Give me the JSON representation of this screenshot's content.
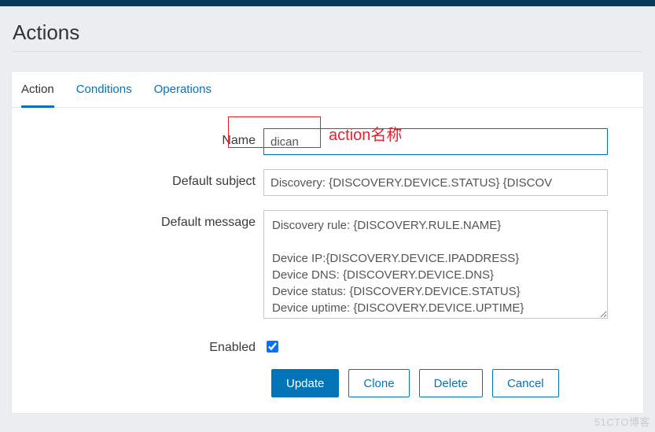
{
  "page": {
    "title": "Actions"
  },
  "tabs": {
    "action": "Action",
    "conditions": "Conditions",
    "operations": "Operations"
  },
  "form": {
    "labels": {
      "name": "Name",
      "default_subject": "Default subject",
      "default_message": "Default message",
      "enabled": "Enabled"
    },
    "values": {
      "name": "dican",
      "default_subject": "Discovery: {DISCOVERY.DEVICE.STATUS} {DISCOV",
      "default_message": "Discovery rule: {DISCOVERY.RULE.NAME}\n\nDevice IP:{DISCOVERY.DEVICE.IPADDRESS}\nDevice DNS: {DISCOVERY.DEVICE.DNS}\nDevice status: {DISCOVERY.DEVICE.STATUS}\nDevice uptime: {DISCOVERY.DEVICE.UPTIME}\n",
      "enabled": true
    }
  },
  "buttons": {
    "update": "Update",
    "clone": "Clone",
    "delete": "Delete",
    "cancel": "Cancel"
  },
  "annotation": {
    "name_hint": "action名称"
  },
  "watermark": "51CTO博客"
}
